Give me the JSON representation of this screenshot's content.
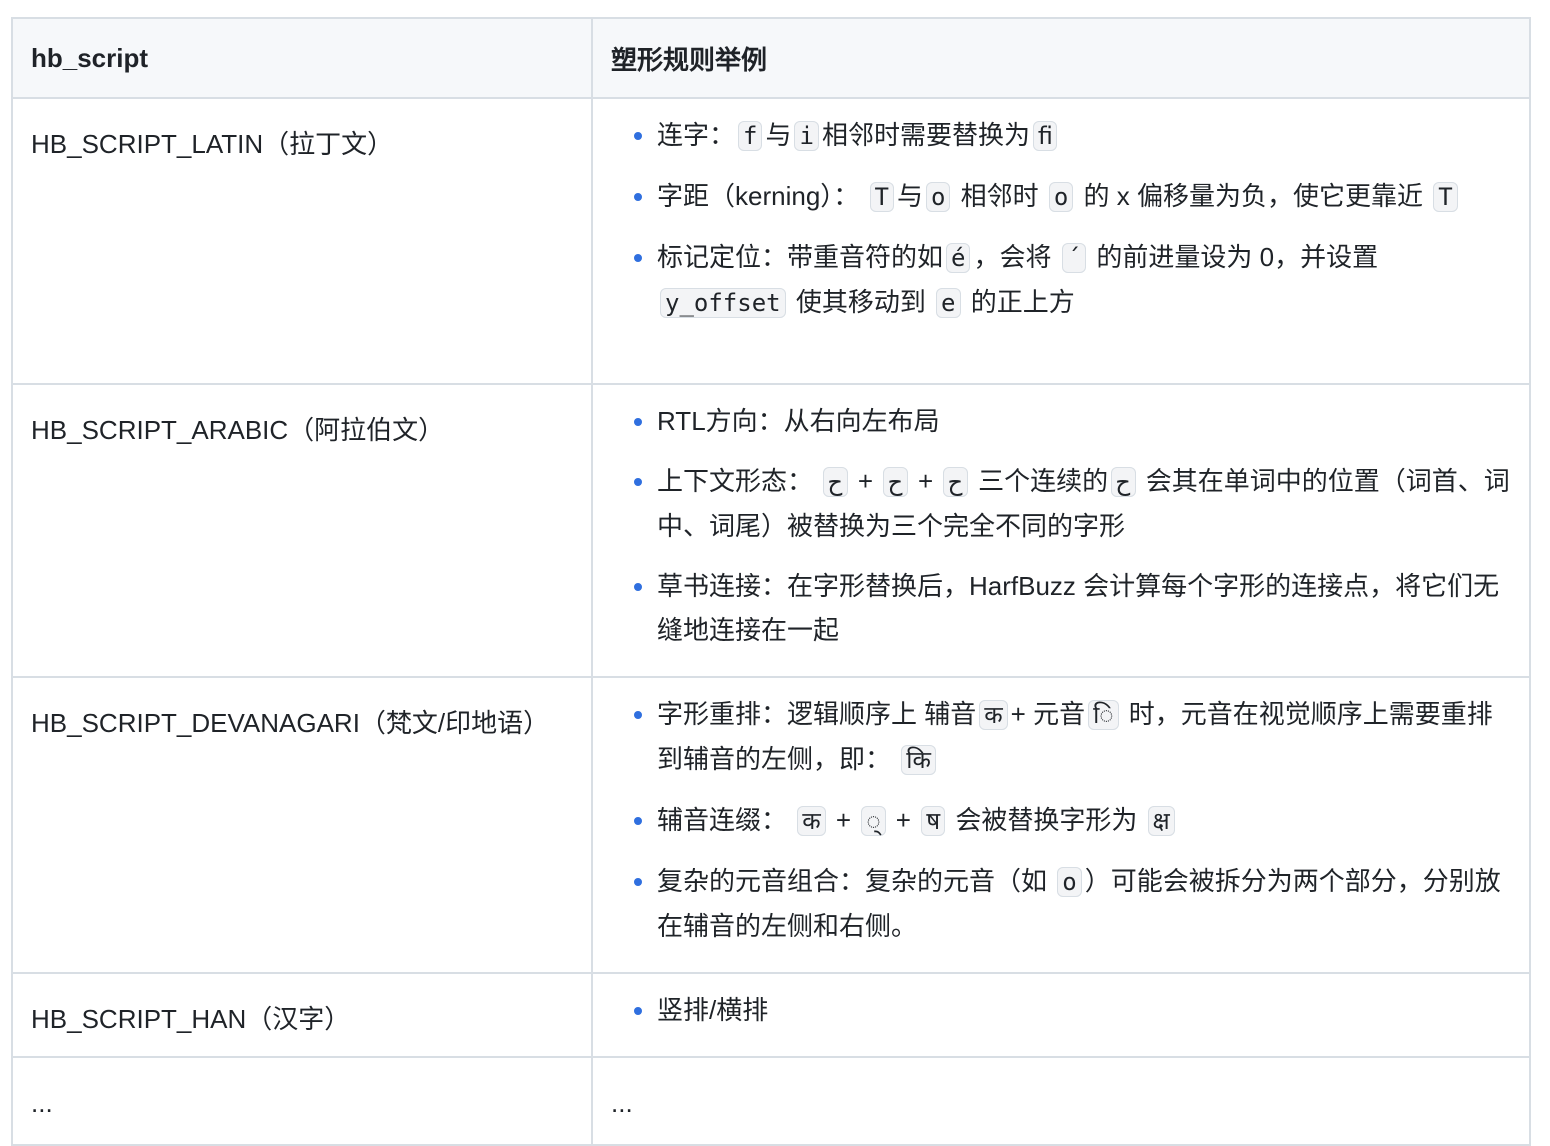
{
  "header": {
    "col1": "hb_script",
    "col2": "塑形规则举例"
  },
  "rows": [
    {
      "script": "HB_SCRIPT_LATIN（拉丁文）",
      "rules": [
        [
          {
            "t": "连字："
          },
          {
            "t": "f",
            "code": true
          },
          {
            "t": "与"
          },
          {
            "t": "i",
            "code": true
          },
          {
            "t": "相邻时需要替换为"
          },
          {
            "t": "ﬁ",
            "code": true
          }
        ],
        [
          {
            "t": "字距（kerning）： "
          },
          {
            "t": "T",
            "code": true
          },
          {
            "t": "与"
          },
          {
            "t": "o",
            "code": true
          },
          {
            "t": " 相邻时 "
          },
          {
            "t": "o",
            "code": true
          },
          {
            "t": " 的 x 偏移量为负，使它更靠近 "
          },
          {
            "t": "T",
            "code": true
          }
        ],
        [
          {
            "t": "标记定位：带重音符的如"
          },
          {
            "t": "é",
            "code": true
          },
          {
            "t": "，会将 "
          },
          {
            "t": "´",
            "code": true
          },
          {
            "t": " 的前进量设为 0，并设置 "
          },
          {
            "t": "y_offset",
            "code": true
          },
          {
            "t": " 使其移动到 "
          },
          {
            "t": "e",
            "code": true
          },
          {
            "t": " 的正上方"
          }
        ]
      ]
    },
    {
      "script": "HB_SCRIPT_ARABIC（阿拉伯文）",
      "rules": [
        [
          {
            "t": "RTL方向：从右向左布局"
          }
        ],
        [
          {
            "t": "上下文形态： "
          },
          {
            "t": "ح",
            "code": true
          },
          {
            "t": " + "
          },
          {
            "t": "ح",
            "code": true
          },
          {
            "t": " + "
          },
          {
            "t": "ح",
            "code": true
          },
          {
            "t": " 三个连续的"
          },
          {
            "t": "ح",
            "code": true
          },
          {
            "t": " 会其在单词中的位置（词首、词中、词尾）被替换为三个完全不同的字形"
          }
        ],
        [
          {
            "t": "草书连接：在字形替换后，HarfBuzz 会计算每个字形的连接点，将它们无缝地连接在一起"
          }
        ]
      ]
    },
    {
      "script": "HB_SCRIPT_DEVANAGARI（梵文/印地语）",
      "rules": [
        [
          {
            "t": "字形重排：逻辑顺序上 辅音"
          },
          {
            "t": "क",
            "code": true
          },
          {
            "t": "+ 元音"
          },
          {
            "t": "ि",
            "code": true
          },
          {
            "t": " 时，元音在视觉顺序上需要重排到辅音的左侧，即： "
          },
          {
            "t": "कि",
            "code": true
          }
        ],
        [
          {
            "t": "辅音连缀： "
          },
          {
            "t": "क",
            "code": true
          },
          {
            "t": " + "
          },
          {
            "t": "्",
            "code": true
          },
          {
            "t": " + "
          },
          {
            "t": "ष",
            "code": true
          },
          {
            "t": " 会被替换字形为 "
          },
          {
            "t": "क्ष",
            "code": true
          }
        ],
        [
          {
            "t": "复杂的元音组合：复杂的元音（如 "
          },
          {
            "t": "o",
            "code": true
          },
          {
            "t": "）可能会被拆分为两个部分，分别放在辅音的左侧和右侧。"
          }
        ]
      ]
    },
    {
      "script": "HB_SCRIPT_HAN（汉字）",
      "rules": [
        [
          {
            "t": "竖排/横排"
          }
        ]
      ]
    },
    {
      "script": "...",
      "rules": [],
      "extra": "..."
    }
  ]
}
